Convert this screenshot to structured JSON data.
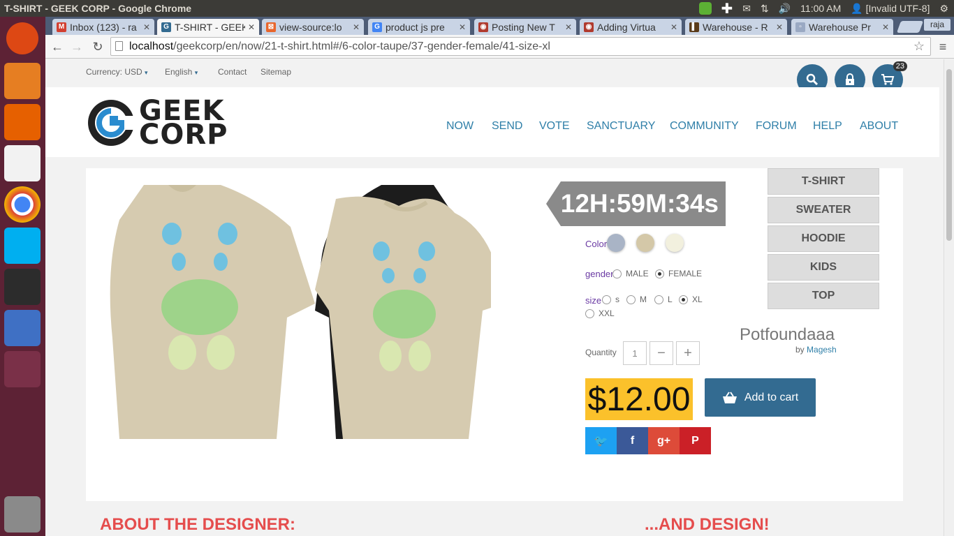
{
  "os": {
    "window_title": "T-SHIRT - GEEK CORP - Google Chrome",
    "clock": "11:00 AM",
    "user": "[Invalid UTF-8]"
  },
  "launcher": [
    {
      "name": "ubuntu-dash-icon",
      "color": "#dd4814"
    },
    {
      "name": "files-icon",
      "color": "#e67e22"
    },
    {
      "name": "firefox-icon",
      "color": "#e66000"
    },
    {
      "name": "text-editor-icon",
      "color": "#f2f2f2"
    },
    {
      "name": "chrome-icon",
      "color": "#4caf50"
    },
    {
      "name": "skype-icon",
      "color": "#00aff0"
    },
    {
      "name": "terminal-icon",
      "color": "#2c2c2c"
    },
    {
      "name": "virtualbox-icon",
      "color": "#3f70c4"
    },
    {
      "name": "workspace-switcher-icon",
      "color": "#7a3048"
    },
    {
      "name": "trash-icon",
      "color": "#8a8a8a"
    }
  ],
  "tabs": [
    {
      "label": "Inbox (123) - ra",
      "fav": "M",
      "fav_color": "#d23f31"
    },
    {
      "label": "T-SHIRT - GEEK",
      "fav": "G",
      "fav_color": "#336b91",
      "active": true
    },
    {
      "label": "view-source:lo",
      "fav": "⊠",
      "fav_color": "#e8662d"
    },
    {
      "label": "product js pre",
      "fav": "G",
      "fav_color": "#4285f4"
    },
    {
      "label": "Posting New T",
      "fav": "◉",
      "fav_color": "#b03a2e"
    },
    {
      "label": "Adding Virtua",
      "fav": "◉",
      "fav_color": "#b03a2e"
    },
    {
      "label": "Warehouse - R",
      "fav": "▌",
      "fav_color": "#5a3b1a"
    },
    {
      "label": "Warehouse Pr",
      "fav": "▫",
      "fav_color": "#9aa9c3"
    }
  ],
  "chrome_user": "raja",
  "url": {
    "host": "localhost",
    "path": "/geekcorp/en/now/21-t-shirt.html#/6-color-taupe/37-gender-female/41-size-xl"
  },
  "util": {
    "currency": "Currency: USD",
    "language": "English",
    "contact": "Contact",
    "sitemap": "Sitemap",
    "cart_count": "23"
  },
  "logo": {
    "line1": "GEEK",
    "line2": "CORP"
  },
  "nav": [
    "NOW",
    "SEND",
    "VOTE",
    "SANCTUARY",
    "COMMUNITY",
    "FORUM",
    "HELP",
    "ABOUT"
  ],
  "product": {
    "timer": "12H:59M:34s",
    "color_label": "Color",
    "colors": [
      "#a9b4c6",
      "#d4c8a8",
      "#f2f0de"
    ],
    "gender_label": "gender",
    "genders": [
      "MALE",
      "FEMALE"
    ],
    "gender_selected": "FEMALE",
    "size_label": "size",
    "sizes": [
      "s",
      "M",
      "L",
      "XL",
      "XXL"
    ],
    "size_selected": "XL",
    "quantity_label": "Quantity",
    "quantity": "1",
    "name": "Potfoundaaa",
    "by": "by",
    "author": "Magesh",
    "price": "$12.00",
    "add_to_cart": "Add to cart",
    "shirt_color": "#d6cbb0"
  },
  "categories": [
    "T-SHIRT",
    "SWEATER",
    "HOODIE",
    "KIDS",
    "TOP"
  ],
  "share": [
    {
      "name": "twitter-share-button",
      "glyph": "🐦",
      "color": "#1da1f2"
    },
    {
      "name": "facebook-share-button",
      "glyph": "f",
      "color": "#3b5998"
    },
    {
      "name": "googleplus-share-button",
      "glyph": "g+",
      "color": "#dd4b39"
    },
    {
      "name": "pinterest-share-button",
      "glyph": "P",
      "color": "#cb2027"
    }
  ],
  "sections": {
    "designer": "ABOUT THE DESIGNER:",
    "design": "...AND DESIGN!"
  }
}
